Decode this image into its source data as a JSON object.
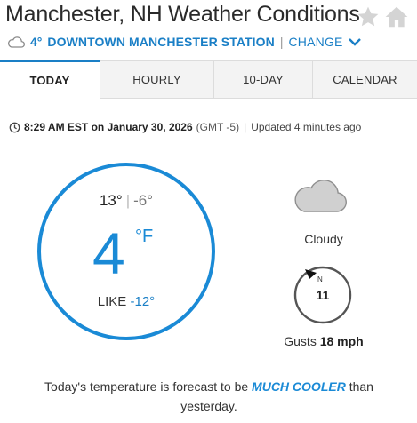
{
  "header": {
    "title": "Manchester, NH Weather Conditions",
    "icons": {
      "favorite": "star-icon",
      "home": "home-icon"
    }
  },
  "station": {
    "temp": "4°",
    "name": "DOWNTOWN MANCHESTER STATION",
    "separator": "|",
    "change_label": "CHANGE"
  },
  "tabs": [
    {
      "label": "TODAY",
      "active": true
    },
    {
      "label": "HOURLY",
      "active": false
    },
    {
      "label": "10-DAY",
      "active": false
    },
    {
      "label": "CALENDAR",
      "active": false
    }
  ],
  "timestamp": {
    "time_date": "8:29 AM EST on January 30, 2026",
    "gmt": "(GMT -5)",
    "separator": "|",
    "updated": "Updated 4 minutes ago"
  },
  "current": {
    "high": "13°",
    "bar": "|",
    "low": "-6°",
    "temp": "4",
    "unit": "°F",
    "feels_like_label": "LIKE",
    "feels_like": "-12°"
  },
  "conditions": {
    "summary": "Cloudy",
    "wind_direction": "N",
    "wind_speed": "11",
    "gusts_label": "Gusts",
    "gusts_value": "18 mph"
  },
  "forecast": {
    "prefix": "Today's temperature is forecast to be",
    "highlight": "MUCH COOLER",
    "suffix": "than yesterday."
  },
  "colors": {
    "accent": "#1a8ad6",
    "link": "#1a7fc6",
    "icon_gray": "#d0d0d0"
  }
}
